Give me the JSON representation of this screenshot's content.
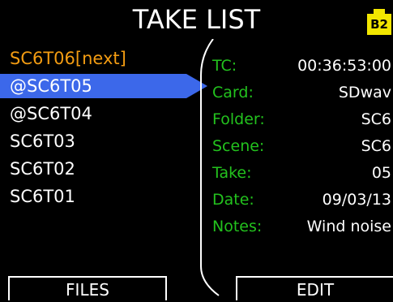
{
  "title": "TAKE LIST",
  "battery": {
    "label": "B2",
    "color": "#f2e600"
  },
  "takes": [
    {
      "label": "SC6T06[next]",
      "state": "next"
    },
    {
      "label": "@SC6T05",
      "state": "selected"
    },
    {
      "label": "@SC6T04",
      "state": "normal"
    },
    {
      "label": "SC6T03",
      "state": "normal"
    },
    {
      "label": "SC6T02",
      "state": "normal"
    },
    {
      "label": "SC6T01",
      "state": "normal"
    }
  ],
  "details": {
    "tc": {
      "key": "TC:",
      "value": "00:36:53:00"
    },
    "card": {
      "key": "Card:",
      "value": "SDwav"
    },
    "folder": {
      "key": "Folder:",
      "value": "SC6"
    },
    "scene": {
      "key": "Scene:",
      "value": "SC6"
    },
    "take": {
      "key": "Take:",
      "value": "05"
    },
    "date": {
      "key": "Date:",
      "value": "09/03/13"
    },
    "notes": {
      "key": "Notes:",
      "value": "Wind noise"
    }
  },
  "softkeys": {
    "left": "FILES",
    "right": "EDIT"
  },
  "colors": {
    "selection": "#3c68ea",
    "next": "#f39c12",
    "key": "#23c21e",
    "background": "#000000"
  }
}
